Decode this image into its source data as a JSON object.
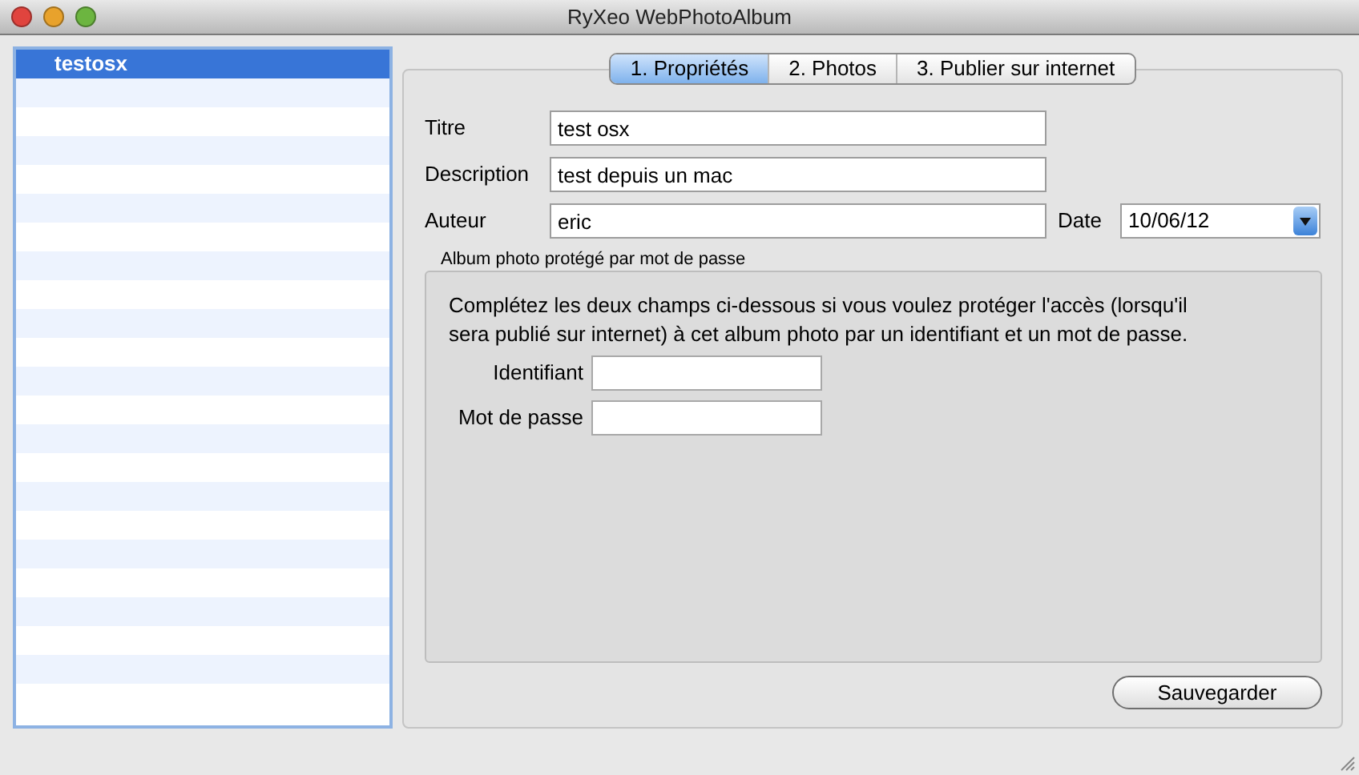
{
  "window": {
    "title": "RyXeo WebPhotoAlbum"
  },
  "sidebar": {
    "items": [
      {
        "label": "testosx",
        "selected": true
      }
    ]
  },
  "tabs": [
    {
      "label": "1. Propriétés",
      "selected": true
    },
    {
      "label": "2. Photos",
      "selected": false
    },
    {
      "label": "3. Publier sur internet",
      "selected": false
    }
  ],
  "properties": {
    "title": {
      "label": "Titre",
      "value": "test osx"
    },
    "description": {
      "label": "Description",
      "value": "test depuis un mac"
    },
    "author": {
      "label": "Auteur",
      "value": "eric"
    },
    "date": {
      "label": "Date",
      "value": "10/06/12"
    }
  },
  "password_group": {
    "title": "Album photo protégé par mot de passe",
    "instructions": "Complétez les deux champs ci-dessous si vous voulez protéger l'accès (lorsqu'il sera publié sur internet) à cet album photo par un identifiant et un mot de passe.",
    "fields": [
      {
        "label": "Identifiant"
      },
      {
        "label": "Mot de passe"
      }
    ]
  },
  "buttons": [
    {
      "label": "Sauvegarder"
    }
  ]
}
